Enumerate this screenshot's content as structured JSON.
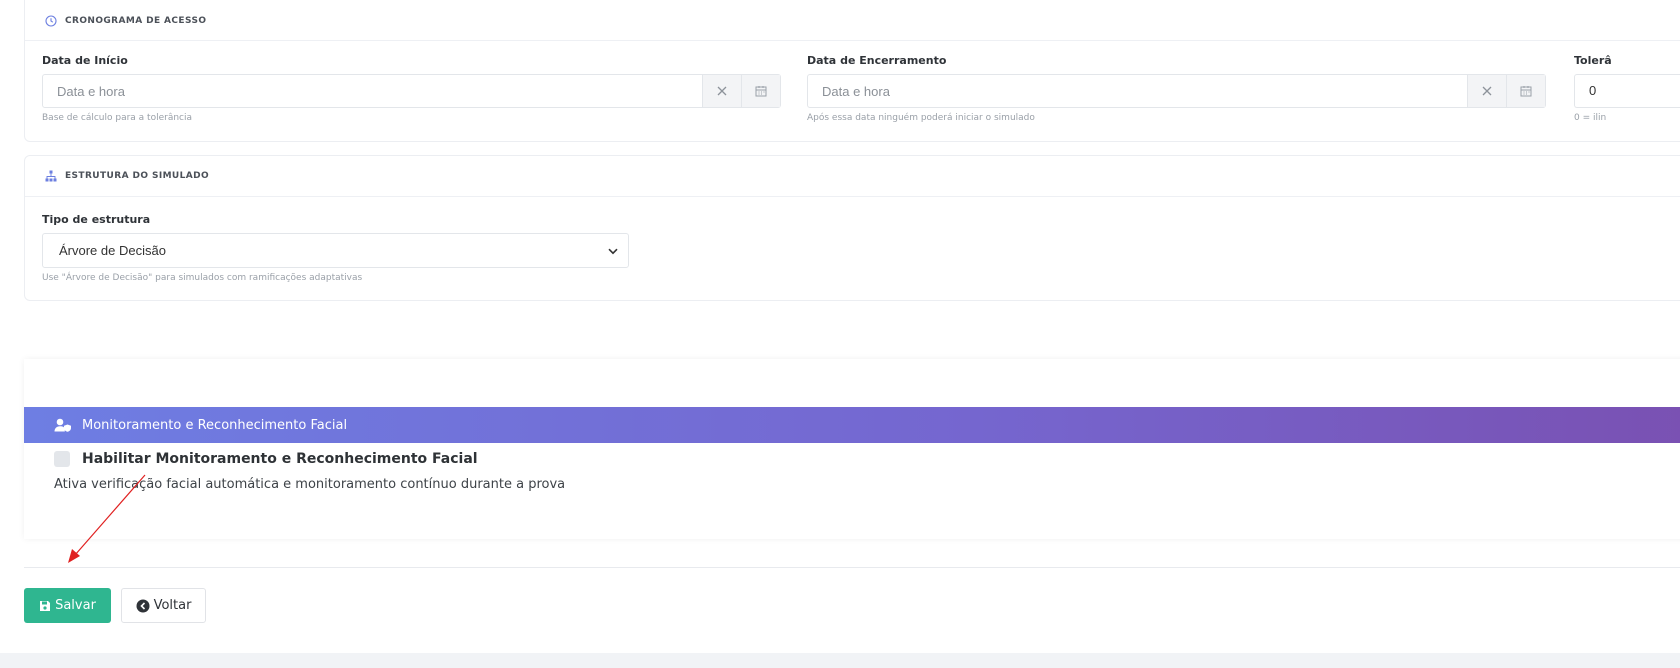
{
  "schedule": {
    "header": "CRONOGRAMA DE ACESSO",
    "header_icon": "clock-icon",
    "start": {
      "label": "Data de Início",
      "placeholder": "Data e hora",
      "help": "Base de cálculo para a tolerância"
    },
    "end": {
      "label": "Data de Encerramento",
      "placeholder": "Data e hora",
      "help": "Após essa data ninguém poderá iniciar o simulado"
    },
    "tolerance": {
      "label": "Tolerâ",
      "value": "0",
      "help": "0 = ilin"
    }
  },
  "structure": {
    "header": "ESTRUTURA DO SIMULADO",
    "header_icon": "sitemap-icon",
    "type_label": "Tipo de estrutura",
    "type_value": "Árvore de Decisão",
    "help": "Use \"Árvore de Decisão\" para simulados com ramificações adaptativas"
  },
  "monitoring": {
    "title": "Monitoramento e Reconhecimento Facial",
    "checkbox_label": "Habilitar Monitoramento e Reconhecimento Facial",
    "description": "Ativa verificação facial automática e monitoramento contínuo durante a prova",
    "checked": false
  },
  "actions": {
    "save_label": "Salvar",
    "back_label": "Voltar"
  },
  "colors": {
    "primary_save": "#2fb690",
    "banner_start": "#6e7ee3",
    "banner_end": "#7a4fb0",
    "annotation_arrow": "#e02020"
  }
}
